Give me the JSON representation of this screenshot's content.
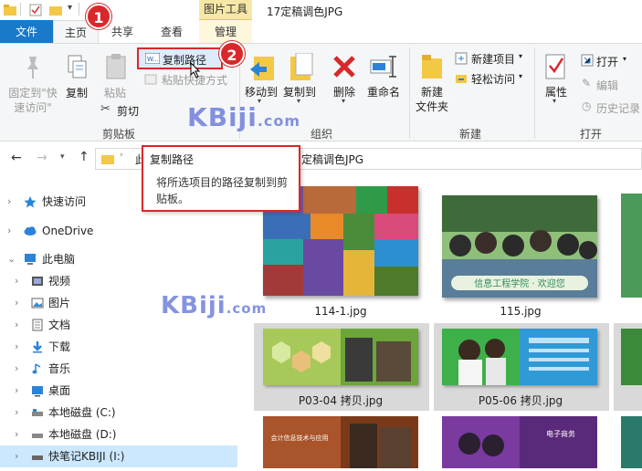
{
  "window": {
    "context_tab": "图片工具",
    "title": "17定稿调色JPG"
  },
  "tabs": {
    "file": "文件",
    "home": "主页",
    "share": "共享",
    "view": "查看",
    "manage": "管理"
  },
  "ribbon": {
    "pin_label_1": "固定到\"快",
    "pin_label_2": "速访问\"",
    "copy": "复制",
    "paste": "粘贴",
    "copy_path": "复制路径",
    "paste_shortcut": "粘贴快捷方式",
    "cut": "剪切",
    "group_clipboard": "剪贴板",
    "move_to": "移动到",
    "copy_to": "复制到",
    "delete": "删除",
    "rename": "重命名",
    "group_organize": "组织",
    "new_folder_1": "新建",
    "new_folder_2": "文件夹",
    "new_item": "新建项目",
    "easy_access": "轻松访问",
    "group_new": "新建",
    "properties": "属性",
    "open": "打开",
    "edit": "编辑",
    "history": "历史记录",
    "group_open": "打开"
  },
  "address": {
    "path_start": "此",
    "path_end": "定稿调色JPG"
  },
  "tooltip": {
    "title": "复制路径",
    "body": "将所选项目的路径复制到剪贴板。"
  },
  "badges": [
    "1",
    "2"
  ],
  "watermark": "KBiji",
  "watermark_suffix": ".com",
  "sidebar": {
    "items": [
      {
        "label": "快速访问",
        "icon": "star-icon"
      },
      {
        "label": "OneDrive",
        "icon": "cloud-icon"
      },
      {
        "label": "此电脑",
        "icon": "computer-icon"
      },
      {
        "label": "视频",
        "icon": "video-icon"
      },
      {
        "label": "图片",
        "icon": "picture-icon"
      },
      {
        "label": "文档",
        "icon": "document-icon"
      },
      {
        "label": "下载",
        "icon": "download-icon"
      },
      {
        "label": "音乐",
        "icon": "music-icon"
      },
      {
        "label": "桌面",
        "icon": "desktop-icon"
      },
      {
        "label": "本地磁盘 (C:)",
        "icon": "drive-icon"
      },
      {
        "label": "本地磁盘 (D:)",
        "icon": "drive-icon"
      },
      {
        "label": "快笔记KBIJI (I:)",
        "icon": "drive-icon"
      }
    ]
  },
  "files": [
    {
      "name": "114-1.jpg"
    },
    {
      "name": "115.jpg"
    },
    {
      "name": "P03-04 拷贝.jpg"
    },
    {
      "name": "P05-06 拷贝.jpg"
    }
  ],
  "photo_captions": {
    "banner_115": "信息工程学院 · 欢迎您",
    "p07_banner": "会计信息技术与应用",
    "p09_banner": "电子商务"
  },
  "colors": {
    "accent": "#1979ca",
    "highlight_red": "#d8282b",
    "selection": "#cce8ff"
  }
}
